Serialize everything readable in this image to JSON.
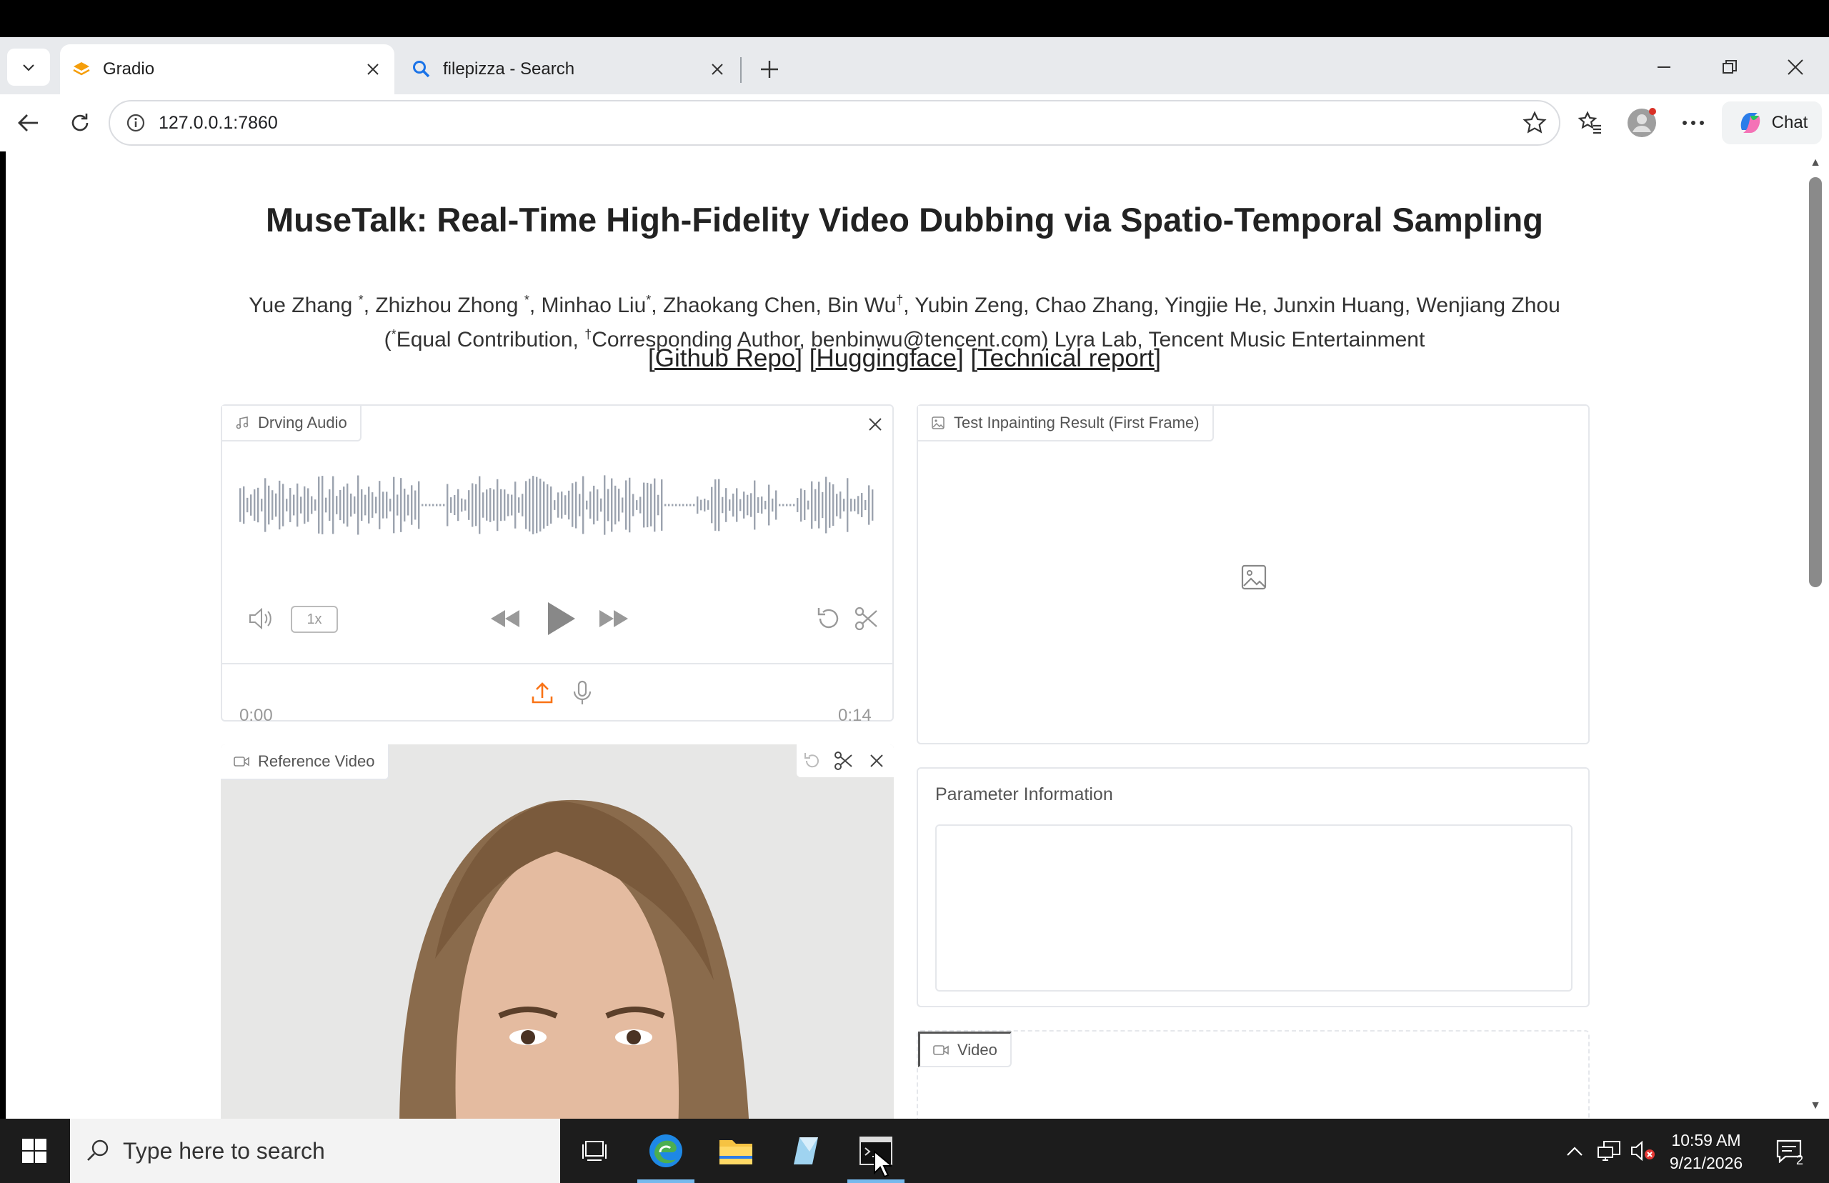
{
  "browser": {
    "tabs": [
      {
        "title": "Gradio",
        "favicon": "gradio-logo-icon",
        "active": true
      },
      {
        "title": "filepizza - Search",
        "favicon": "search-icon",
        "active": false
      }
    ],
    "url": "127.0.0.1:7860",
    "chat_label": "Chat"
  },
  "page": {
    "title": "MuseTalk: Real-Time High-Fidelity Video Dubbing via Spatio-Temporal Sampling",
    "authors_line1": [
      {
        "name": "Yue Zhang ",
        "mark": "*"
      },
      {
        "name": ", Zhizhou Zhong ",
        "mark": "*"
      },
      {
        "name": ", Minhao Liu",
        "mark": "*"
      },
      {
        "name": ", Zhaokang Chen, Bin Wu",
        "mark": "†"
      },
      {
        "name": ", Yubin Zeng, Chao Zhang, Yingjie He, Junxin Huang, Wenjiang Zhou",
        "mark": ""
      }
    ],
    "authors_line2_parts": [
      "(",
      "*",
      "Equal Contribution, ",
      "†",
      "Corresponding Author, benbinwu@tencent.com) Lyra Lab, Tencent Music Entertainment"
    ],
    "links": [
      "[Github Repo]",
      "[Huggingface]",
      "[Technical report]"
    ]
  },
  "audio_panel": {
    "label": "Drving Audio",
    "time_start": "0:00",
    "time_end": "0:14",
    "speed": "1x"
  },
  "inpaint_panel": {
    "label": "Test Inpainting Result (First Frame)"
  },
  "reference_panel": {
    "label": "Reference Video"
  },
  "param_panel": {
    "title": "Parameter Information",
    "value": ""
  },
  "video_panel": {
    "label": "Video"
  },
  "taskbar": {
    "search_placeholder": "Type here to search",
    "time": "10:59 AM",
    "date": "9/21/2026",
    "notification_count": "2"
  }
}
